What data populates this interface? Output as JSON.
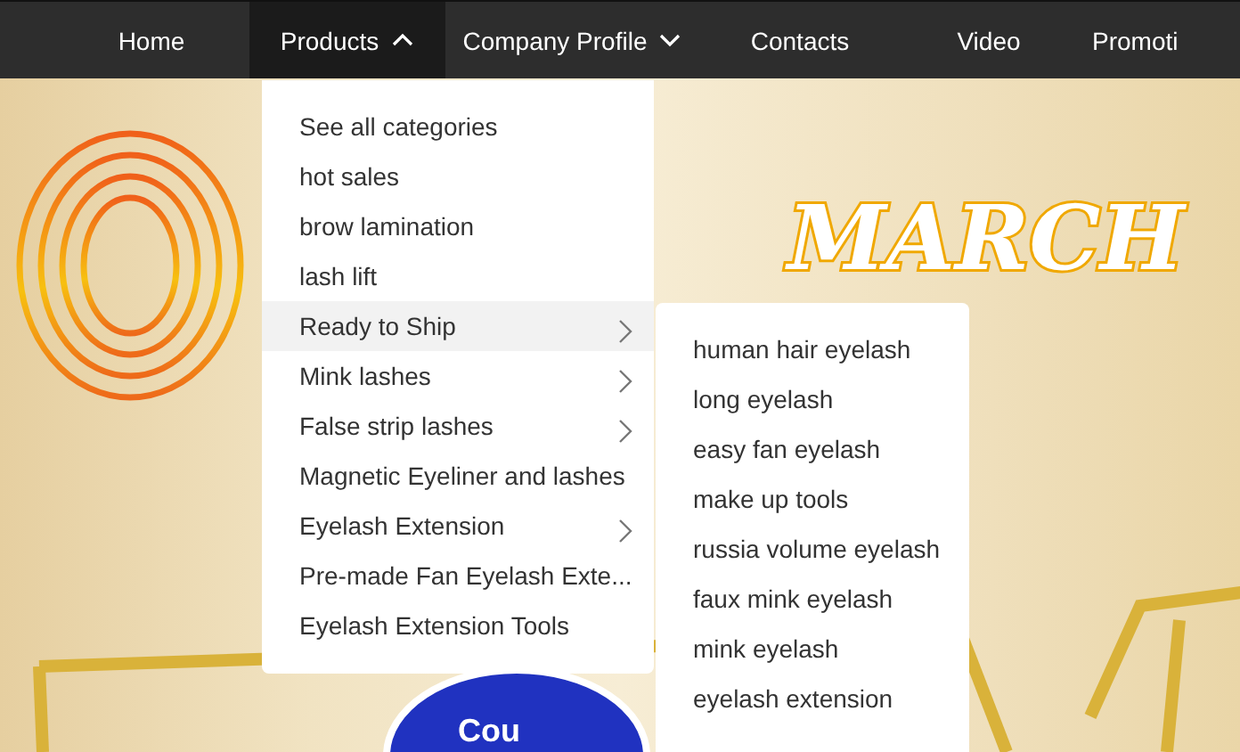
{
  "nav": {
    "items": [
      {
        "label": "Home",
        "selected": false,
        "has_menu": false
      },
      {
        "label": "Products",
        "selected": true,
        "has_menu": true,
        "expanded": true
      },
      {
        "label": "Company Profile",
        "selected": false,
        "has_menu": true,
        "expanded": false
      },
      {
        "label": "Contacts",
        "selected": false,
        "has_menu": false
      },
      {
        "label": "Video",
        "selected": false,
        "has_menu": false
      },
      {
        "label": "Promoti",
        "selected": false,
        "has_menu": false
      }
    ]
  },
  "banner": {
    "heading": "MARCH",
    "badge": "Cou"
  },
  "dropdown": {
    "items": [
      {
        "label": "See all categories",
        "selected": false,
        "submenu": false
      },
      {
        "label": "hot sales",
        "selected": false,
        "submenu": false
      },
      {
        "label": "brow lamination",
        "selected": false,
        "submenu": false
      },
      {
        "label": "lash lift",
        "selected": false,
        "submenu": false
      },
      {
        "label": "Ready to Ship",
        "selected": true,
        "submenu": true
      },
      {
        "label": "Mink lashes",
        "selected": false,
        "submenu": true
      },
      {
        "label": "False strip lashes",
        "selected": false,
        "submenu": true
      },
      {
        "label": "Magnetic Eyeliner and lashes",
        "selected": false,
        "submenu": false
      },
      {
        "label": "Eyelash Extension",
        "selected": false,
        "submenu": true
      },
      {
        "label": "Pre-made Fan Eyelash Exte...",
        "selected": false,
        "submenu": false
      },
      {
        "label": "Eyelash Extension Tools",
        "selected": false,
        "submenu": false
      }
    ]
  },
  "submenu": {
    "items": [
      "human hair eyelash",
      "long eyelash",
      "easy fan eyelash",
      "make up tools",
      "russia volume eyelash",
      "faux mink eyelash",
      "mink eyelash",
      "eyelash extension"
    ]
  }
}
